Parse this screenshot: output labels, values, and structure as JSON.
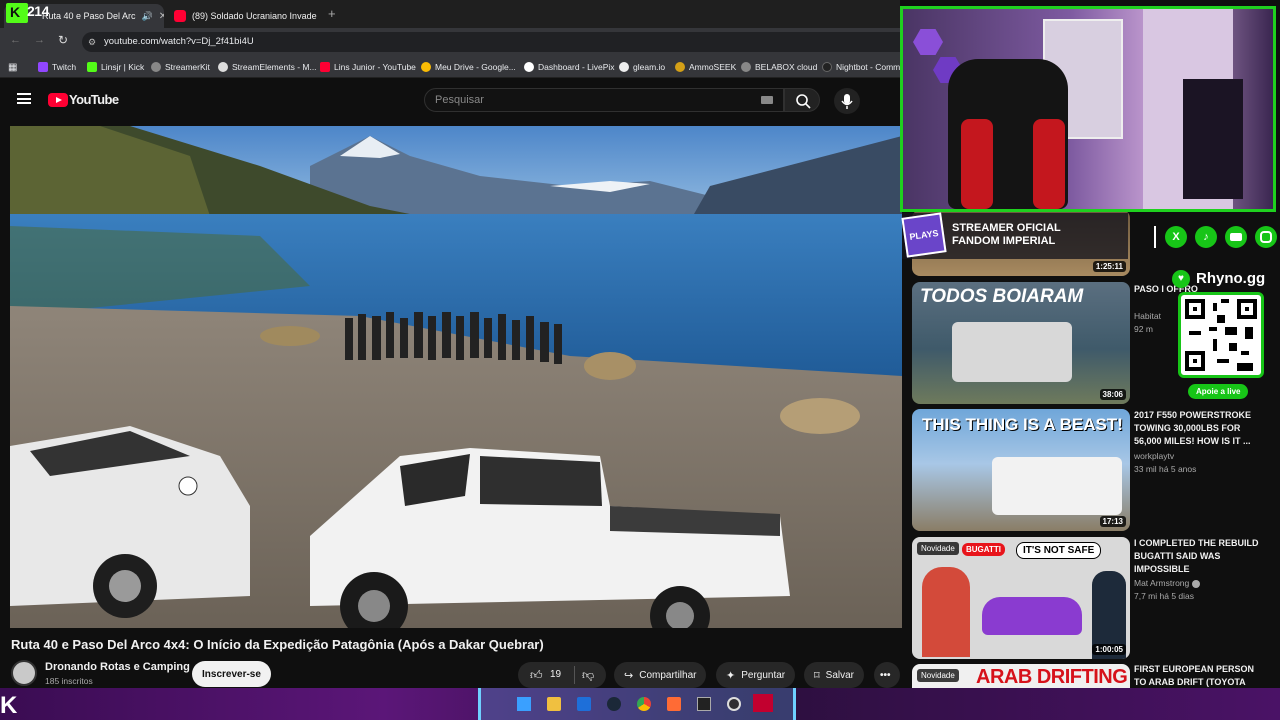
{
  "stream_overlay": {
    "counter": "214"
  },
  "browser": {
    "tabs": [
      {
        "label": "Ruta 40 e Paso Del Arc",
        "active": true
      },
      {
        "label": "(89) Soldado Ucraniano Invade",
        "active": false
      }
    ],
    "url": "youtube.com/watch?v=Dj_2f41bi4U",
    "bookmarks": [
      "Twitch",
      "Linsjr | Kick",
      "StreamerKit",
      "StreamElements - M...",
      "Lins Junior - YouTube",
      "Meu Drive - Google...",
      "Dashboard - LivePix",
      "gleam.io",
      "AmmoSEEK",
      "BELABOX cloud",
      "Nightbot - Comm"
    ]
  },
  "youtube": {
    "logo_text": "YouTube",
    "search_placeholder": "Pesquisar"
  },
  "video": {
    "title": "Ruta 40 e Paso Del Arco 4x4: O Início da Expedição Patagônia (Após a Dakar Quebrar)",
    "channel": "Dronando Rotas e Camping",
    "subscribers": "185 inscritos",
    "subscribe_label": "Inscrever-se",
    "likes": "19",
    "share_label": "Compartilhar",
    "ask_label": "Perguntar",
    "save_label": "Salvar"
  },
  "overlay_banner": {
    "line1": "STREAMER OFICIAL",
    "line2": "FANDOM IMPERIAL",
    "badge": "PLAYS"
  },
  "socials_brand": "Rhyno.gg",
  "qr_caption": "Apoie a live",
  "sidebar": [
    {
      "duration": "1:25:11"
    },
    {
      "thumb_text": "TODOS BOIARAM",
      "title": "PASO I OFFRO",
      "channel": "Habitat",
      "meta": "92 m",
      "duration": "38:06"
    },
    {
      "thumb_text": "THIS THING IS A BEAST!",
      "title": "2017 F550 POWERSTROKE TOWING 30,000lbs FOR 56,000 MILES! HOW IS IT ...",
      "channel": "workplaytv",
      "meta": "33 mil  há 5 anos",
      "duration": "17:13"
    },
    {
      "thumb_text": "IT'S NOT SAFE",
      "thumb_tag": "BUGATTI",
      "badge": "Novidade",
      "title": "I COMPLETED THE REBUILD BUGATTI SAID WAS IMPOSSIBLE",
      "channel": "Mat Armstrong",
      "meta": "7,7 mi  há 5 dias",
      "duration": "1:00:05"
    },
    {
      "thumb_text": "ARAB DRIFTING",
      "badge": "Novidade",
      "title": "FIRST EUROPEAN PERSON TO ARAB DRIFT (Toyota"
    }
  ]
}
